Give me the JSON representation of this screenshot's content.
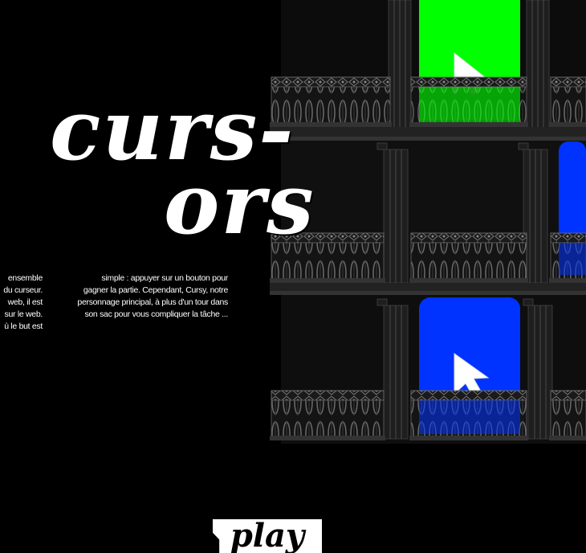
{
  "game": {
    "title_line_1": "curs-",
    "title_line_2": "ors",
    "play_label": "play"
  },
  "intro": {
    "col1_lines": [
      "ensemble",
      "du curseur.",
      "web, il est",
      "sur le web.",
      "ù le but est"
    ],
    "col2_lines": [
      "simple : appuyer sur un bouton pour",
      "gagner la partie. Cependant, Cursy, notre",
      "personnage principal, à plus d'un tour dans",
      "son sac pour vous compliquer la tâche ..."
    ]
  },
  "colors": {
    "background": "#000000",
    "window_green": "#00ff00",
    "window_blue": "#0033ff",
    "building_dark": "#1a1a1a",
    "railing_gray": "#555555",
    "title_white": "#ffffff"
  },
  "building": {
    "windows": [
      {
        "floor": 1,
        "column": "center",
        "color": "green",
        "cursor_icon": "arrow-cursor-icon"
      },
      {
        "floor": 2,
        "column": "right",
        "color": "blue",
        "cursor_icon": ""
      },
      {
        "floor": 3,
        "column": "center",
        "color": "blue",
        "cursor_icon": "arrow-cursor-icon"
      }
    ]
  }
}
